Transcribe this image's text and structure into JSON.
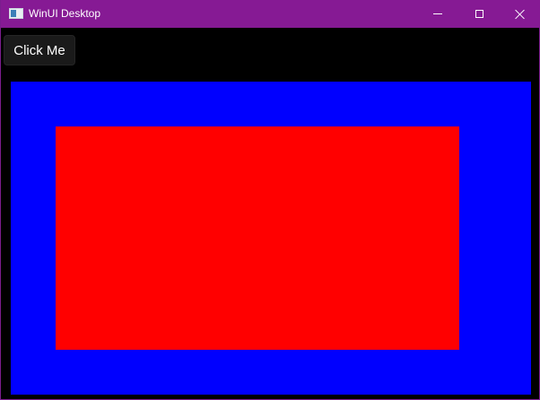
{
  "window": {
    "title": "WinUI Desktop",
    "app_icon": "app-window-icon",
    "titlebar_color": "#861a94",
    "caption_buttons": {
      "minimize": "minimize-icon",
      "maximize": "maximize-icon",
      "close": "close-icon"
    }
  },
  "content": {
    "button_label": "Click Me",
    "outer_rect_color": "#0000ff",
    "inner_rect_color": "#ff0000",
    "background_color": "#000000"
  }
}
